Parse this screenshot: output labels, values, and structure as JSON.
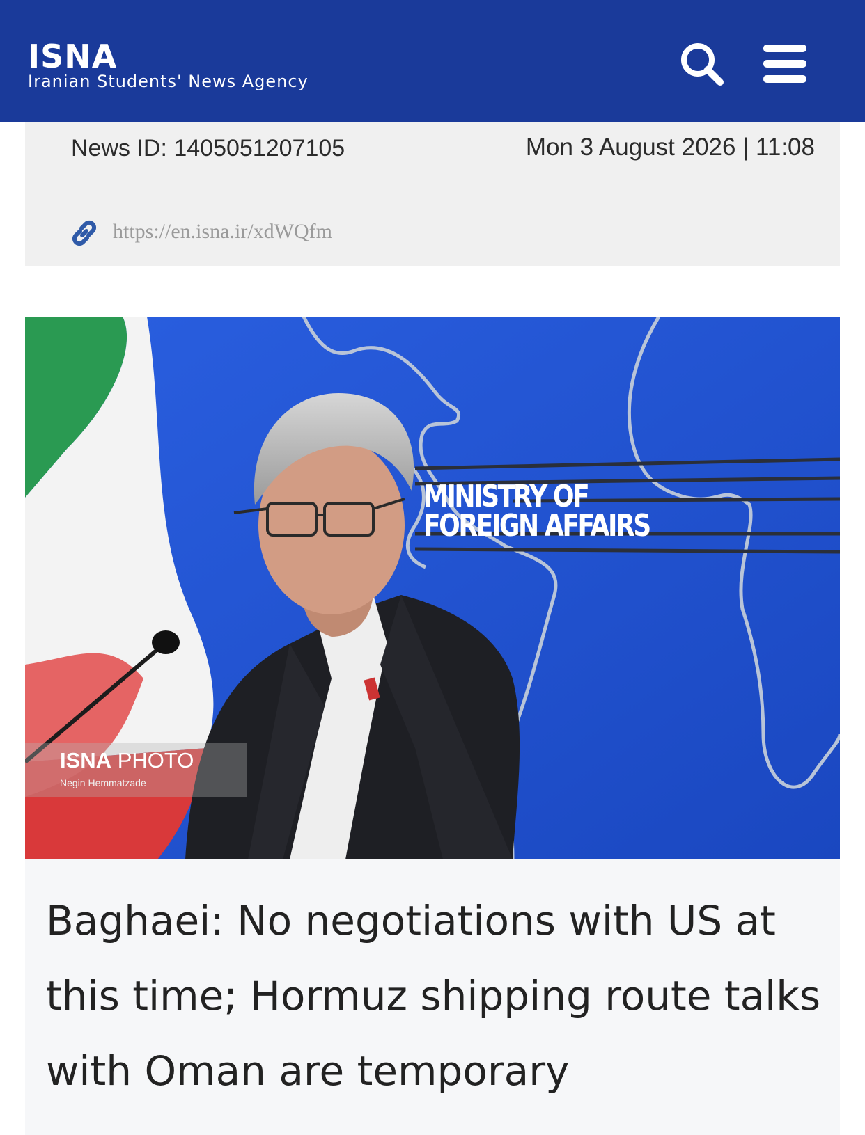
{
  "header": {
    "logo_title": "ISNA",
    "logo_subtitle": "Iranian Students' News Agency",
    "background_color": "#1a3a9a",
    "icons": [
      "search-icon",
      "hamburger-menu-icon"
    ]
  },
  "meta": {
    "news_id": "News ID: 1405051207105",
    "date_time": "Mon 3 August 2026 | 11:08",
    "short_link": "https://en.isna.ir/xdWQfm",
    "link_icon": "link-icon"
  },
  "photo": {
    "sign_line1": "MINISTRY OF",
    "sign_line2": "FOREIGN AFFAIRS",
    "credit_brand_bold": "ISNA",
    "credit_brand_rest": " PHOTO",
    "credit_name": "Negin Hemmatzade"
  },
  "article": {
    "title": "Baghaei: No negotiations with US at this time; Hormuz shipping route talks with Oman are temporary"
  }
}
